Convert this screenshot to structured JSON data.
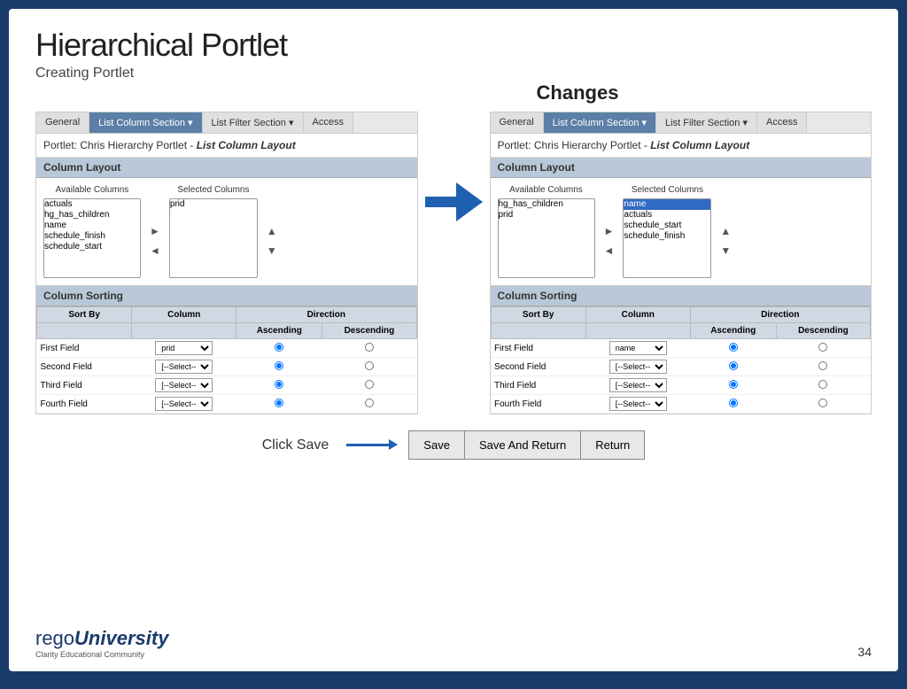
{
  "title": {
    "main": "Hierarchical Portlet",
    "subtitle": "Creating Portlet"
  },
  "changes_label": "Changes",
  "left_panel": {
    "tabs": [
      {
        "label": "General",
        "active": false
      },
      {
        "label": "List Column Section ▾",
        "active": true
      },
      {
        "label": "List Filter Section ▾",
        "active": false
      },
      {
        "label": "Access",
        "active": false
      }
    ],
    "portlet_title": "Portlet: Chris Hierarchy Portlet - ",
    "portlet_title_italic": "List Column Layout",
    "column_layout_header": "Column Layout",
    "available_columns_label": "Available Columns",
    "selected_columns_label": "Selected Columns",
    "available_columns": [
      "actuals",
      "hg_has_children",
      "name",
      "schedule_finish",
      "schedule_start"
    ],
    "selected_columns": [
      "prid"
    ],
    "column_sorting_header": "Column Sorting",
    "direction_label": "Direction",
    "sort_columns": [
      "Sort By",
      "Column",
      "Ascending",
      "Descending"
    ],
    "sort_rows": [
      {
        "label": "First Field",
        "column": "prid",
        "ascending": true,
        "descending": false
      },
      {
        "label": "Second Field",
        "column": "--Select--",
        "ascending": true,
        "descending": false
      },
      {
        "label": "Third Field",
        "column": "--Select--",
        "ascending": true,
        "descending": false
      },
      {
        "label": "Fourth Field",
        "column": "--Select--",
        "ascending": true,
        "descending": false
      }
    ]
  },
  "right_panel": {
    "tabs": [
      {
        "label": "General",
        "active": false
      },
      {
        "label": "List Column Section ▾",
        "active": true
      },
      {
        "label": "List Filter Section ▾",
        "active": false
      },
      {
        "label": "Access",
        "active": false
      }
    ],
    "portlet_title": "Portlet: Chris Hierarchy Portlet - ",
    "portlet_title_italic": "List Column Layout",
    "column_layout_header": "Column Layout",
    "available_columns_label": "Available Columns",
    "selected_columns_label": "Selected Columns",
    "available_columns": [
      "hg_has_children",
      "prid"
    ],
    "selected_columns": [
      "name",
      "actuals",
      "schedule_start",
      "schedule_finish"
    ],
    "selected_highlighted": "name",
    "column_sorting_header": "Column Sorting",
    "direction_label": "Direction",
    "sort_rows": [
      {
        "label": "First Field",
        "column": "name",
        "ascending": true,
        "descending": false
      },
      {
        "label": "Second Field",
        "column": "--Select--",
        "ascending": true,
        "descending": false
      },
      {
        "label": "Third Field",
        "column": "--Select--",
        "ascending": true,
        "descending": false
      },
      {
        "label": "Fourth Field",
        "column": "--Select--",
        "ascending": true,
        "descending": false
      }
    ]
  },
  "bottom": {
    "click_save": "Click Save",
    "save": "Save",
    "save_and_return": "Save And Return",
    "return": "Return"
  },
  "footer": {
    "logo_rego": "rego",
    "logo_university": "University",
    "logo_subtitle": "Clarity Educational Community",
    "page_number": "34"
  }
}
